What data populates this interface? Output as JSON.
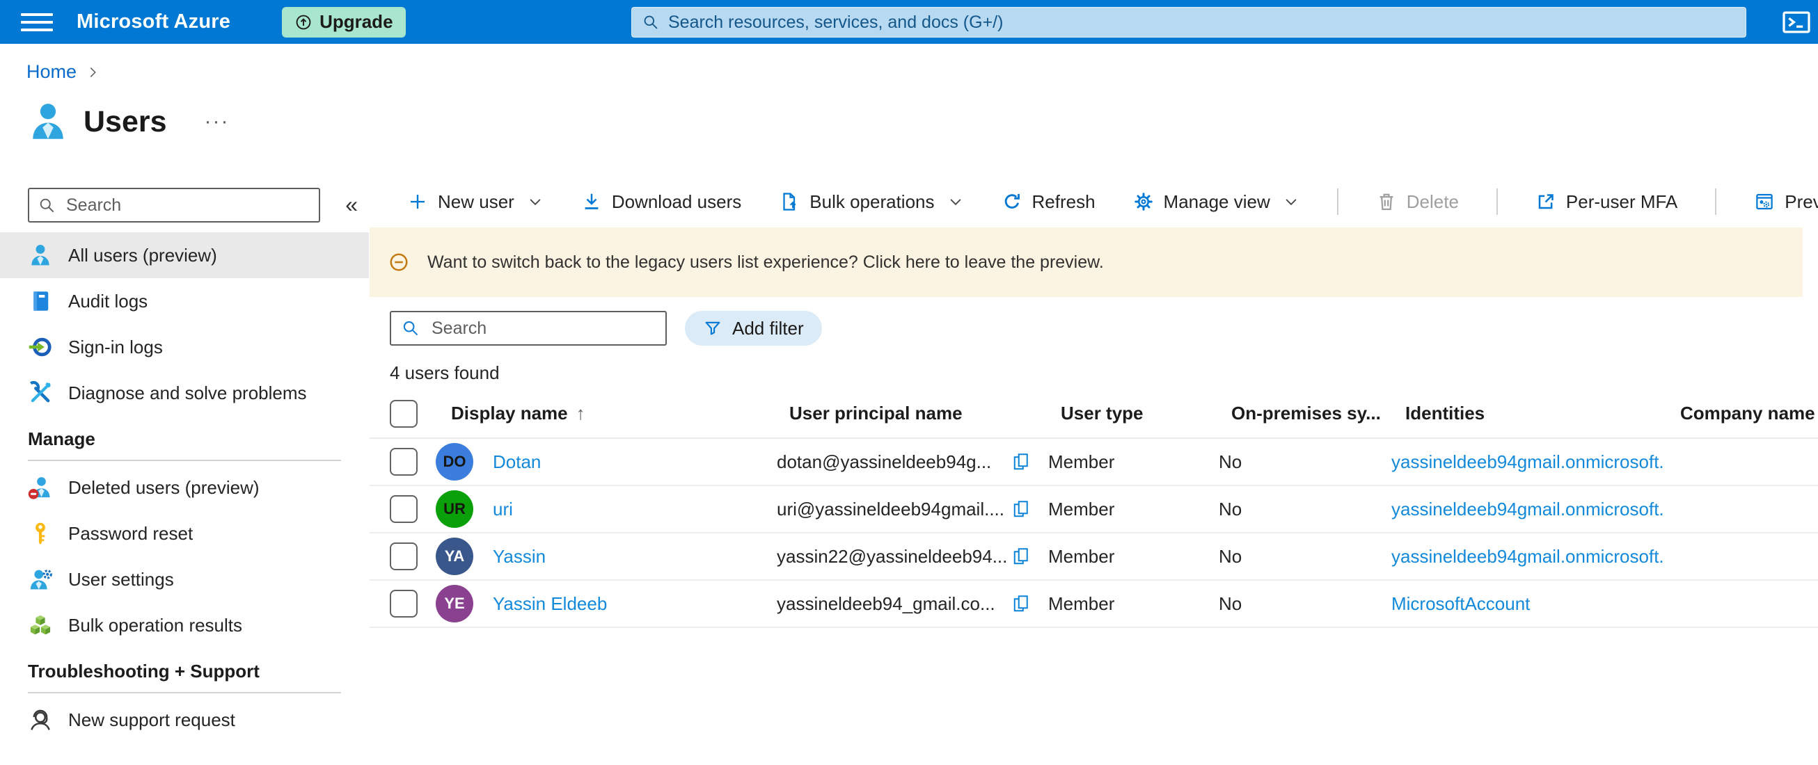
{
  "topbar": {
    "brand": "Microsoft Azure",
    "upgrade_label": "Upgrade",
    "search_placeholder": "Search resources, services, and docs (G+/)"
  },
  "breadcrumb": {
    "home": "Home"
  },
  "page": {
    "title": "Users",
    "overflow": "···"
  },
  "sidebar": {
    "search_placeholder": "Search",
    "collapse": "«",
    "items": [
      {
        "label": "All users (preview)"
      },
      {
        "label": "Audit logs"
      },
      {
        "label": "Sign-in logs"
      },
      {
        "label": "Diagnose and solve problems"
      }
    ],
    "manage_header": "Manage",
    "manage_items": [
      {
        "label": "Deleted users (preview)"
      },
      {
        "label": "Password reset"
      },
      {
        "label": "User settings"
      },
      {
        "label": "Bulk operation results"
      }
    ],
    "support_header": "Troubleshooting + Support",
    "support_items": [
      {
        "label": "New support request"
      }
    ]
  },
  "toolbar": {
    "new_user": "New user",
    "download_users": "Download users",
    "bulk_operations": "Bulk operations",
    "refresh": "Refresh",
    "manage_view": "Manage view",
    "delete": "Delete",
    "per_user_mfa": "Per-user MFA",
    "preview_features": "Preview features"
  },
  "banner": {
    "message": "Want to switch back to the legacy users list experience? Click here to leave the preview."
  },
  "filters": {
    "search_placeholder": "Search",
    "add_filter": "Add filter"
  },
  "results_count": "4 users found",
  "table": {
    "sort_indicator": "↑",
    "columns": {
      "display_name": "Display name",
      "user_principal_name": "User principal name",
      "user_type": "User type",
      "on_premises": "On-premises sy...",
      "identities": "Identities",
      "company_name": "Company name"
    },
    "rows": [
      {
        "initials": "DO",
        "avatar_style": "background:#3b7ddd;color:#16150f",
        "display_name": "Dotan",
        "upn": "dotan@yassineldeeb94g...",
        "user_type": "Member",
        "on_premises": "No",
        "identities": "yassineldeeb94gmail.onmicrosoft.",
        "company_name": ""
      },
      {
        "initials": "UR",
        "avatar_style": "background:#0aa00a;color:#16150f",
        "display_name": "uri",
        "upn": "uri@yassineldeeb94gmail....",
        "user_type": "Member",
        "on_premises": "No",
        "identities": "yassineldeeb94gmail.onmicrosoft.",
        "company_name": ""
      },
      {
        "initials": "YA",
        "avatar_style": "background:#3a578c;color:#ffffff",
        "display_name": "Yassin",
        "upn": "yassin22@yassineldeeb94...",
        "user_type": "Member",
        "on_premises": "No",
        "identities": "yassineldeeb94gmail.onmicrosoft.",
        "company_name": ""
      },
      {
        "initials": "YE",
        "avatar_style": "background:#8a4190;color:#ffffff",
        "display_name": "Yassin Eldeeb",
        "upn": "yassineldeeb94_gmail.co...",
        "user_type": "Member",
        "on_premises": "No",
        "identities": "MicrosoftAccount",
        "company_name": ""
      }
    ]
  },
  "theme": {
    "topbar_blue": "#0078d4",
    "upgrade_mint": "#a8e7cd",
    "topsearch_blue": "#b7d9f2",
    "banner_cream": "#fbf4e3",
    "selected_item_gray": "#e9e9e9",
    "link_blue": "#1289da",
    "disabled_gray": "#a19f9d"
  }
}
